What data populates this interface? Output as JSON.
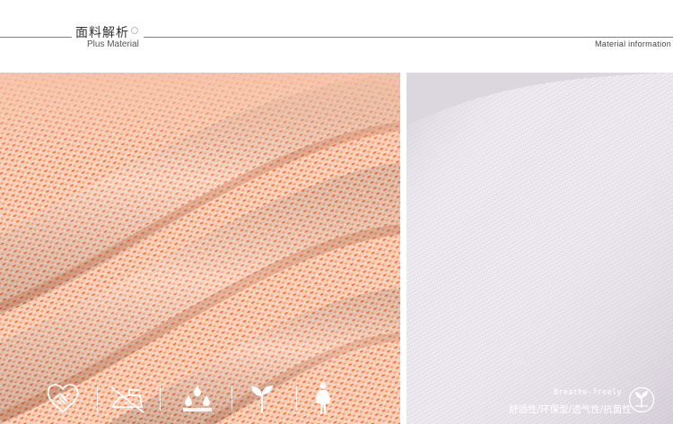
{
  "header": {
    "title_cn": "面料解析",
    "title_en": "Plus Material",
    "info_en": "Material information"
  },
  "swatches": {
    "left": {
      "name": "orange-melange-knit-fabric",
      "base_color": "#f6c4aa",
      "accent_color": "#f26c2b"
    },
    "right": {
      "name": "light-lilac-woven-fabric",
      "base_color": "#e9e4ec"
    }
  },
  "icons": [
    {
      "name": "handshake-heart-icon"
    },
    {
      "name": "iron-icon"
    },
    {
      "name": "water-drops-icon"
    },
    {
      "name": "sprout-icon"
    },
    {
      "name": "woman-figure-icon"
    }
  ],
  "features": {
    "tagline": "Breathe-freely",
    "list": "舒适性/环保型/透气性/抗菌性"
  }
}
